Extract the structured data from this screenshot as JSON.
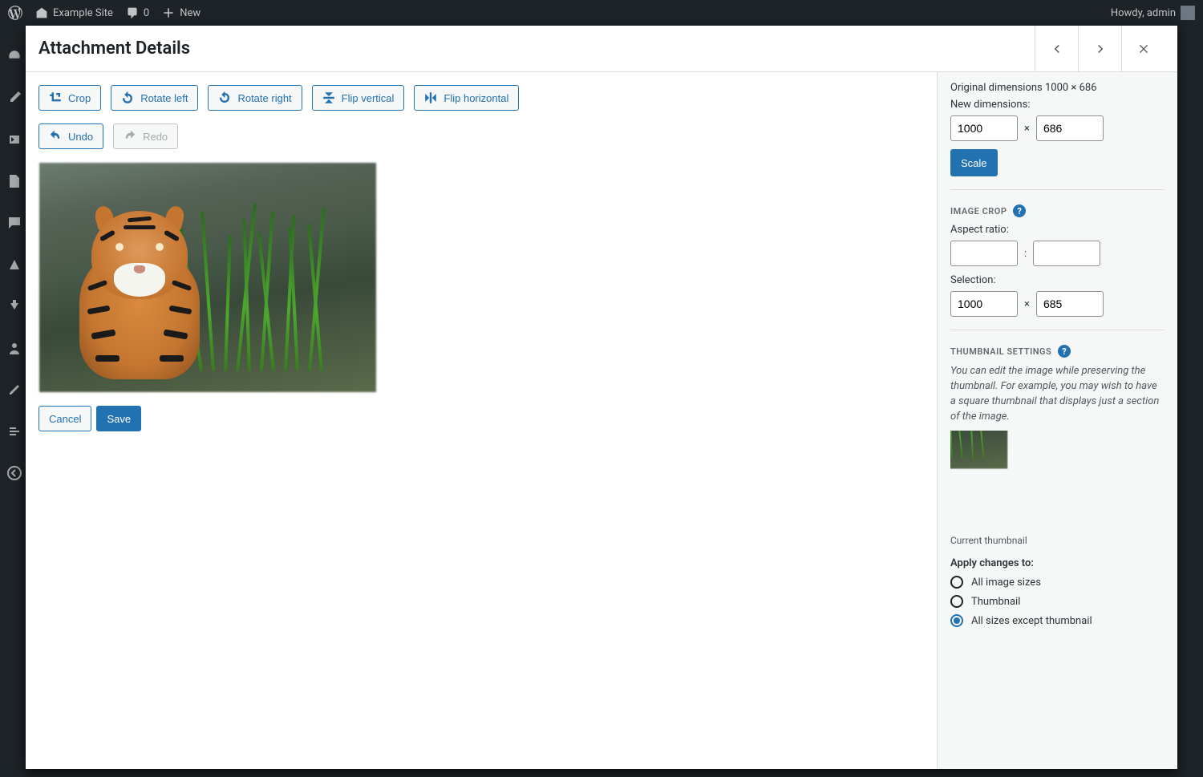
{
  "adminbar": {
    "site_name": "Example Site",
    "comments_count": "0",
    "new_label": "New",
    "howdy": "Howdy, admin"
  },
  "modal": {
    "title": "Attachment Details"
  },
  "toolbar": {
    "crop": "Crop",
    "rotate_left": "Rotate left",
    "rotate_right": "Rotate right",
    "flip_vertical": "Flip vertical",
    "flip_horizontal": "Flip horizontal",
    "undo": "Undo",
    "redo": "Redo"
  },
  "actions": {
    "cancel": "Cancel",
    "save": "Save"
  },
  "side": {
    "original_dimensions": "Original dimensions 1000 × 686",
    "new_dimensions_label": "New dimensions:",
    "width": "1000",
    "height": "686",
    "scale_btn": "Scale",
    "image_crop_heading": "IMAGE CROP",
    "aspect_ratio_label": "Aspect ratio:",
    "aspect_w": "",
    "aspect_h": "",
    "selection_label": "Selection:",
    "sel_w": "1000",
    "sel_h": "685",
    "thumb_heading": "THUMBNAIL SETTINGS",
    "thumb_desc": "You can edit the image while preserving the thumbnail. For example, you may wish to have a square thumbnail that displays just a section of the image.",
    "current_thumbnail": "Current thumbnail",
    "apply_label": "Apply changes to:",
    "option_all": "All image sizes",
    "option_thumb": "Thumbnail",
    "option_except": "All sizes except thumbnail"
  }
}
